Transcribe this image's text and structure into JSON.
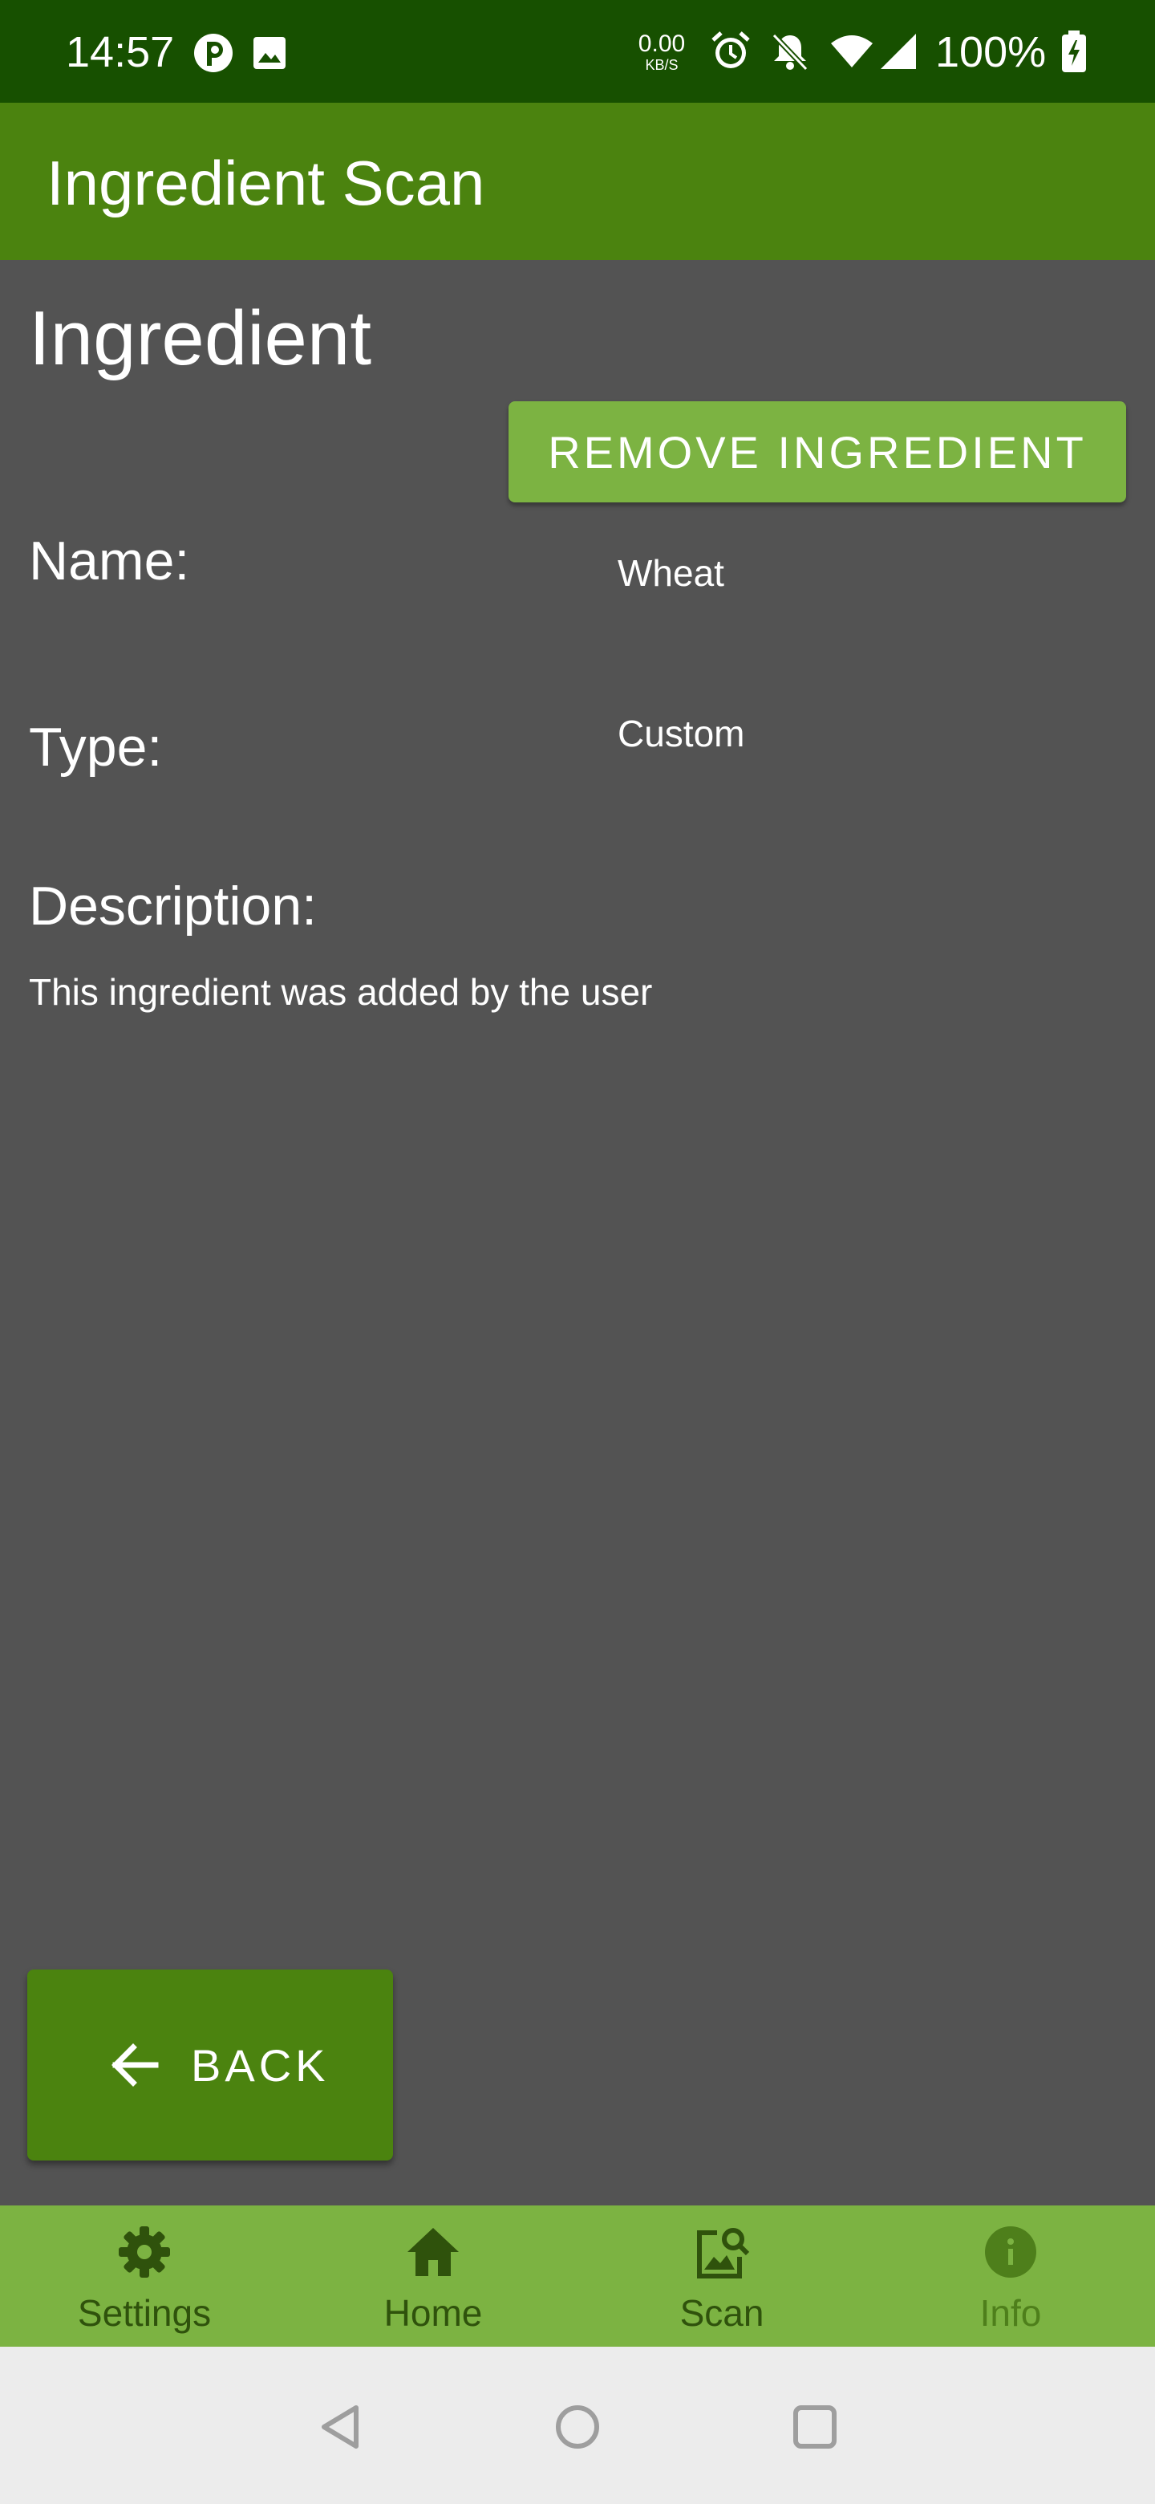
{
  "status_bar": {
    "time": "14:57",
    "network_speed_value": "0.00",
    "network_speed_unit": "KB/S",
    "battery": "100%",
    "icons": [
      "notification-badge-icon",
      "image-icon",
      "alarm-icon",
      "bell-off-icon",
      "wifi-icon",
      "signal-icon",
      "battery-charging-icon"
    ]
  },
  "app_bar": {
    "title": "Ingredient Scan"
  },
  "content": {
    "heading": "Ingredient",
    "remove_button_label": "REMOVE INGREDIENT",
    "name_label": "Name:",
    "name_value": "Wheat",
    "type_label": "Type:",
    "type_value": "Custom",
    "description_label": "Description:",
    "description_text": "This ingredient was added by the user"
  },
  "back_button": {
    "label": "BACK",
    "icon": "arrow-left-icon"
  },
  "bottom_nav": {
    "items": [
      {
        "label": "Settings",
        "icon": "gear-icon",
        "active": false
      },
      {
        "label": "Home",
        "icon": "home-icon",
        "active": false
      },
      {
        "label": "Scan",
        "icon": "image-search-icon",
        "active": false
      },
      {
        "label": "Info",
        "icon": "info-icon",
        "active": true
      }
    ]
  },
  "system_nav": {
    "icons": [
      "back-triangle-icon",
      "home-circle-icon",
      "recents-square-icon"
    ]
  },
  "colors": {
    "status_bar": "#175000",
    "app_bar": "#4b830f",
    "background": "#535353",
    "accent_button": "#7cb342",
    "bottom_nav": "#7cb342",
    "system_nav": "#ececec"
  }
}
